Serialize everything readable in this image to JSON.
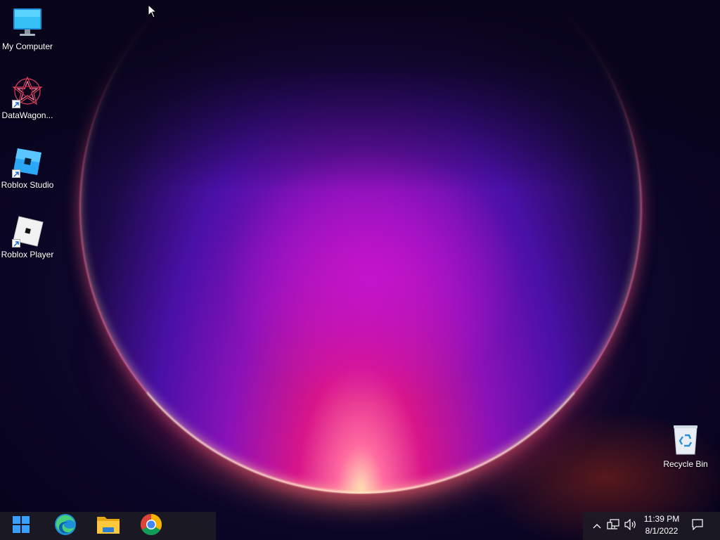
{
  "desktop": {
    "icons": [
      {
        "label": "My Computer",
        "icon": "computer-icon"
      },
      {
        "label": "DataWagon...",
        "icon": "datawagon-icon",
        "shortcut": true
      },
      {
        "label": "Roblox Studio",
        "icon": "roblox-studio-icon",
        "shortcut": true
      },
      {
        "label": "Roblox Player",
        "icon": "roblox-player-icon",
        "shortcut": true
      },
      {
        "label": "Recycle Bin",
        "icon": "recycle-bin-icon"
      }
    ]
  },
  "taskbar": {
    "pinned": [
      {
        "name": "Start",
        "icon": "windows-start-icon"
      },
      {
        "name": "Microsoft Edge",
        "icon": "edge-icon"
      },
      {
        "name": "File Explorer",
        "icon": "file-explorer-icon"
      },
      {
        "name": "Google Chrome",
        "icon": "chrome-icon"
      }
    ],
    "tray": {
      "icons": [
        "chevron-up-icon",
        "network-icon",
        "volume-icon",
        "notification-icon"
      ],
      "time": "11:39 PM",
      "date": "8/1/2022"
    }
  },
  "colors": {
    "taskbar_bg": "#1c1a24",
    "accent_blue": "#3aa0ff"
  }
}
